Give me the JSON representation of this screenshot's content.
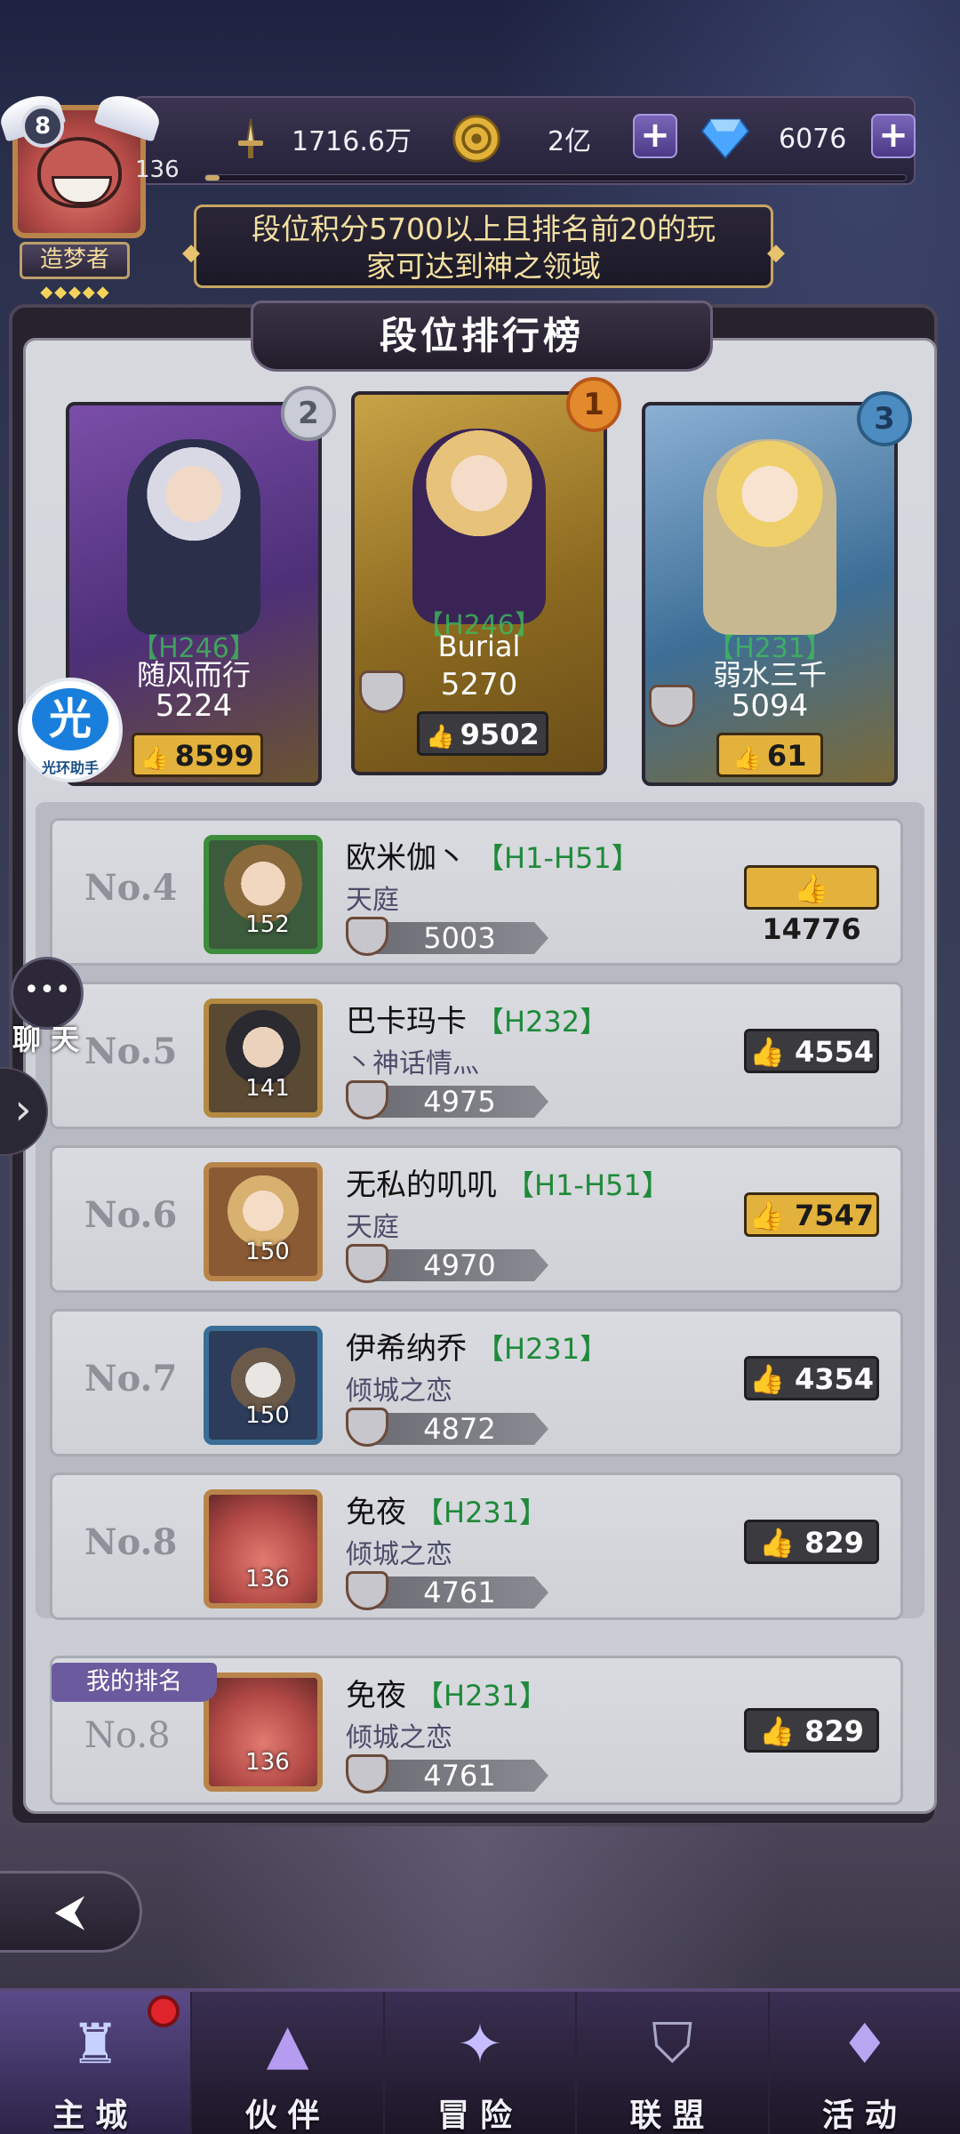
{
  "player": {
    "level_badge": "8",
    "level": "136",
    "exp_fraction": 0.02,
    "title": "造梦者",
    "title_stars": "◆◆◆◆◆"
  },
  "resources": {
    "power": "1716.6万",
    "gold": "2亿",
    "diamonds": "6076"
  },
  "banner": {
    "text_line1": "段位积分5700以上且排名前20的玩",
    "text_line2": "家可达到神之领域"
  },
  "panel": {
    "title": "段位排行榜"
  },
  "podium": [
    {
      "rank": "2",
      "server": "【H246】",
      "name": "随风而行",
      "score": "5224",
      "likes": "8599",
      "like_style": "gold"
    },
    {
      "rank": "1",
      "server": "【H246】",
      "name": "Burial",
      "score": "5270",
      "likes": "9502",
      "like_style": "dark"
    },
    {
      "rank": "3",
      "server": "【H231】",
      "name": "弱水三千",
      "score": "5094",
      "likes": "61",
      "like_style": "gold"
    }
  ],
  "helper": {
    "icon_text": "光",
    "label": "光环助手"
  },
  "chat": {
    "label": "聊 天"
  },
  "rows": [
    {
      "no": "No.4",
      "name": "欧米伽丶",
      "server": "【H1-H51】",
      "guild": "天庭",
      "level": "152",
      "score": "5003",
      "likes": "14776",
      "like_style": "gold",
      "avatar_color": "#3c8c3c"
    },
    {
      "no": "No.5",
      "name": "巴卡玛卡",
      "server": "【H232】",
      "guild": "丶神话情灬",
      "level": "141",
      "score": "4975",
      "likes": "4554",
      "like_style": "dark",
      "avatar_color": "#b48a40"
    },
    {
      "no": "No.6",
      "name": "无私的叽叽",
      "server": "【H1-H51】",
      "guild": "天庭",
      "level": "150",
      "score": "4970",
      "likes": "7547",
      "like_style": "gold",
      "avatar_color": "#b9844a"
    },
    {
      "no": "No.7",
      "name": "伊希纳乔",
      "server": "【H231】",
      "guild": "倾城之恋",
      "level": "150",
      "score": "4872",
      "likes": "4354",
      "like_style": "dark",
      "avatar_color": "#3a6e96"
    },
    {
      "no": "No.8",
      "name": "免夜",
      "server": "【H231】",
      "guild": "倾城之恋",
      "level": "136",
      "score": "4761",
      "likes": "829",
      "like_style": "dark",
      "avatar_color": "#b9844a"
    }
  ],
  "my_rank": {
    "tag": "我的排名",
    "no": "No.8",
    "name": "免夜",
    "server": "【H231】",
    "guild": "倾城之恋",
    "level": "136",
    "score": "4761",
    "likes": "829"
  },
  "nav": [
    {
      "label": "主城",
      "icon": "castle-icon"
    },
    {
      "label": "伙伴",
      "icon": "wizard-hat-icon"
    },
    {
      "label": "冒险",
      "icon": "compass-icon"
    },
    {
      "label": "联盟",
      "icon": "shield-icon"
    },
    {
      "label": "活动",
      "icon": "cards-icon"
    }
  ],
  "colors": {
    "gold_like": "#e3b23c",
    "dark_like": "#3b3b3f",
    "server_green": "#1f8a3a",
    "banner_text": "#f3e0a2"
  }
}
